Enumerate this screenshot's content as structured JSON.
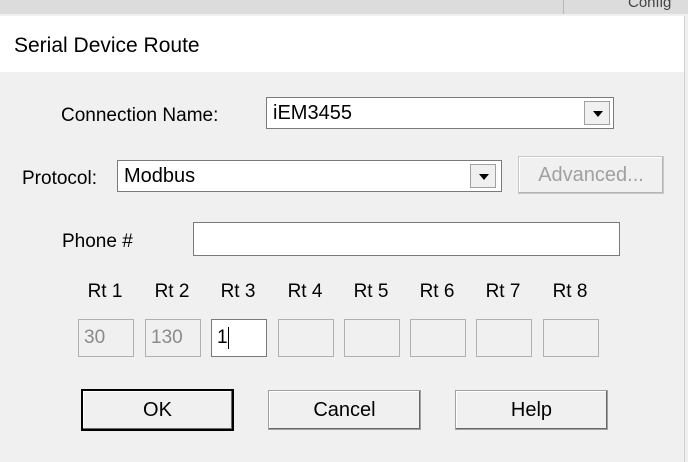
{
  "background": {
    "fragment_text": "Config"
  },
  "dialog": {
    "title": "Serial Device Route",
    "connection_name": {
      "label": "Connection Name:",
      "value": "iEM3455"
    },
    "protocol": {
      "label": "Protocol:",
      "value": "Modbus"
    },
    "advanced_label": "Advanced...",
    "phone": {
      "label": "Phone #",
      "value": ""
    },
    "routes": [
      {
        "label": "Rt 1",
        "value": "30",
        "enabled": false
      },
      {
        "label": "Rt 2",
        "value": "130",
        "enabled": false
      },
      {
        "label": "Rt 3",
        "value": "1",
        "enabled": true
      },
      {
        "label": "Rt 4",
        "value": "",
        "enabled": false
      },
      {
        "label": "Rt 5",
        "value": "",
        "enabled": false
      },
      {
        "label": "Rt 6",
        "value": "",
        "enabled": false
      },
      {
        "label": "Rt 7",
        "value": "",
        "enabled": false
      },
      {
        "label": "Rt 8",
        "value": "",
        "enabled": false
      }
    ],
    "buttons": {
      "ok": "OK",
      "cancel": "Cancel",
      "help": "Help"
    }
  }
}
